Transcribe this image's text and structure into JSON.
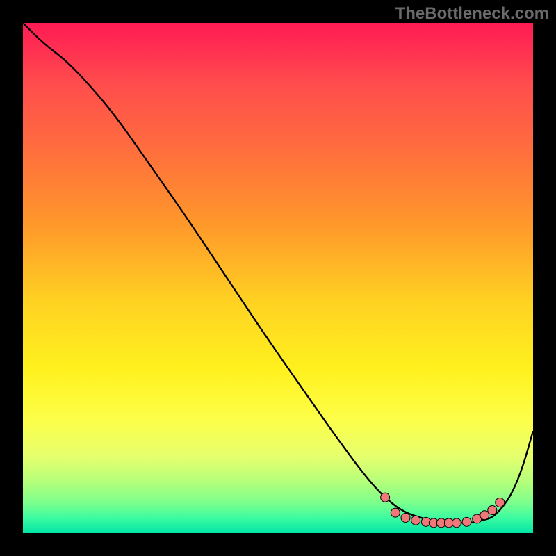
{
  "watermark": "TheBottleneck.com",
  "colors": {
    "curve": "#000000",
    "dot_fill": "#f07878",
    "dot_stroke": "#000000"
  },
  "chart_data": {
    "type": "line",
    "title": "",
    "xlabel": "",
    "ylabel": "",
    "xlim": [
      0,
      100
    ],
    "ylim": [
      0,
      100
    ],
    "x": [
      0,
      4,
      8,
      12,
      18,
      25,
      32,
      40,
      48,
      55,
      62,
      68,
      72,
      75,
      78,
      80,
      82,
      84,
      86,
      88,
      90,
      92,
      94,
      96,
      98,
      100
    ],
    "values": [
      100,
      96,
      93,
      89,
      82,
      72,
      62,
      50,
      38,
      28,
      18,
      10,
      6,
      4,
      3,
      2.5,
      2,
      2,
      2,
      2,
      2.5,
      3,
      5,
      8,
      13,
      20
    ],
    "dots": [
      {
        "x": 71,
        "y": 7
      },
      {
        "x": 73,
        "y": 4
      },
      {
        "x": 75,
        "y": 3
      },
      {
        "x": 77,
        "y": 2.5
      },
      {
        "x": 79,
        "y": 2.2
      },
      {
        "x": 80.5,
        "y": 2
      },
      {
        "x": 82,
        "y": 2
      },
      {
        "x": 83.5,
        "y": 2
      },
      {
        "x": 85,
        "y": 2
      },
      {
        "x": 87,
        "y": 2.2
      },
      {
        "x": 89,
        "y": 2.8
      },
      {
        "x": 90.5,
        "y": 3.5
      },
      {
        "x": 92,
        "y": 4.5
      },
      {
        "x": 93.5,
        "y": 6
      }
    ]
  }
}
